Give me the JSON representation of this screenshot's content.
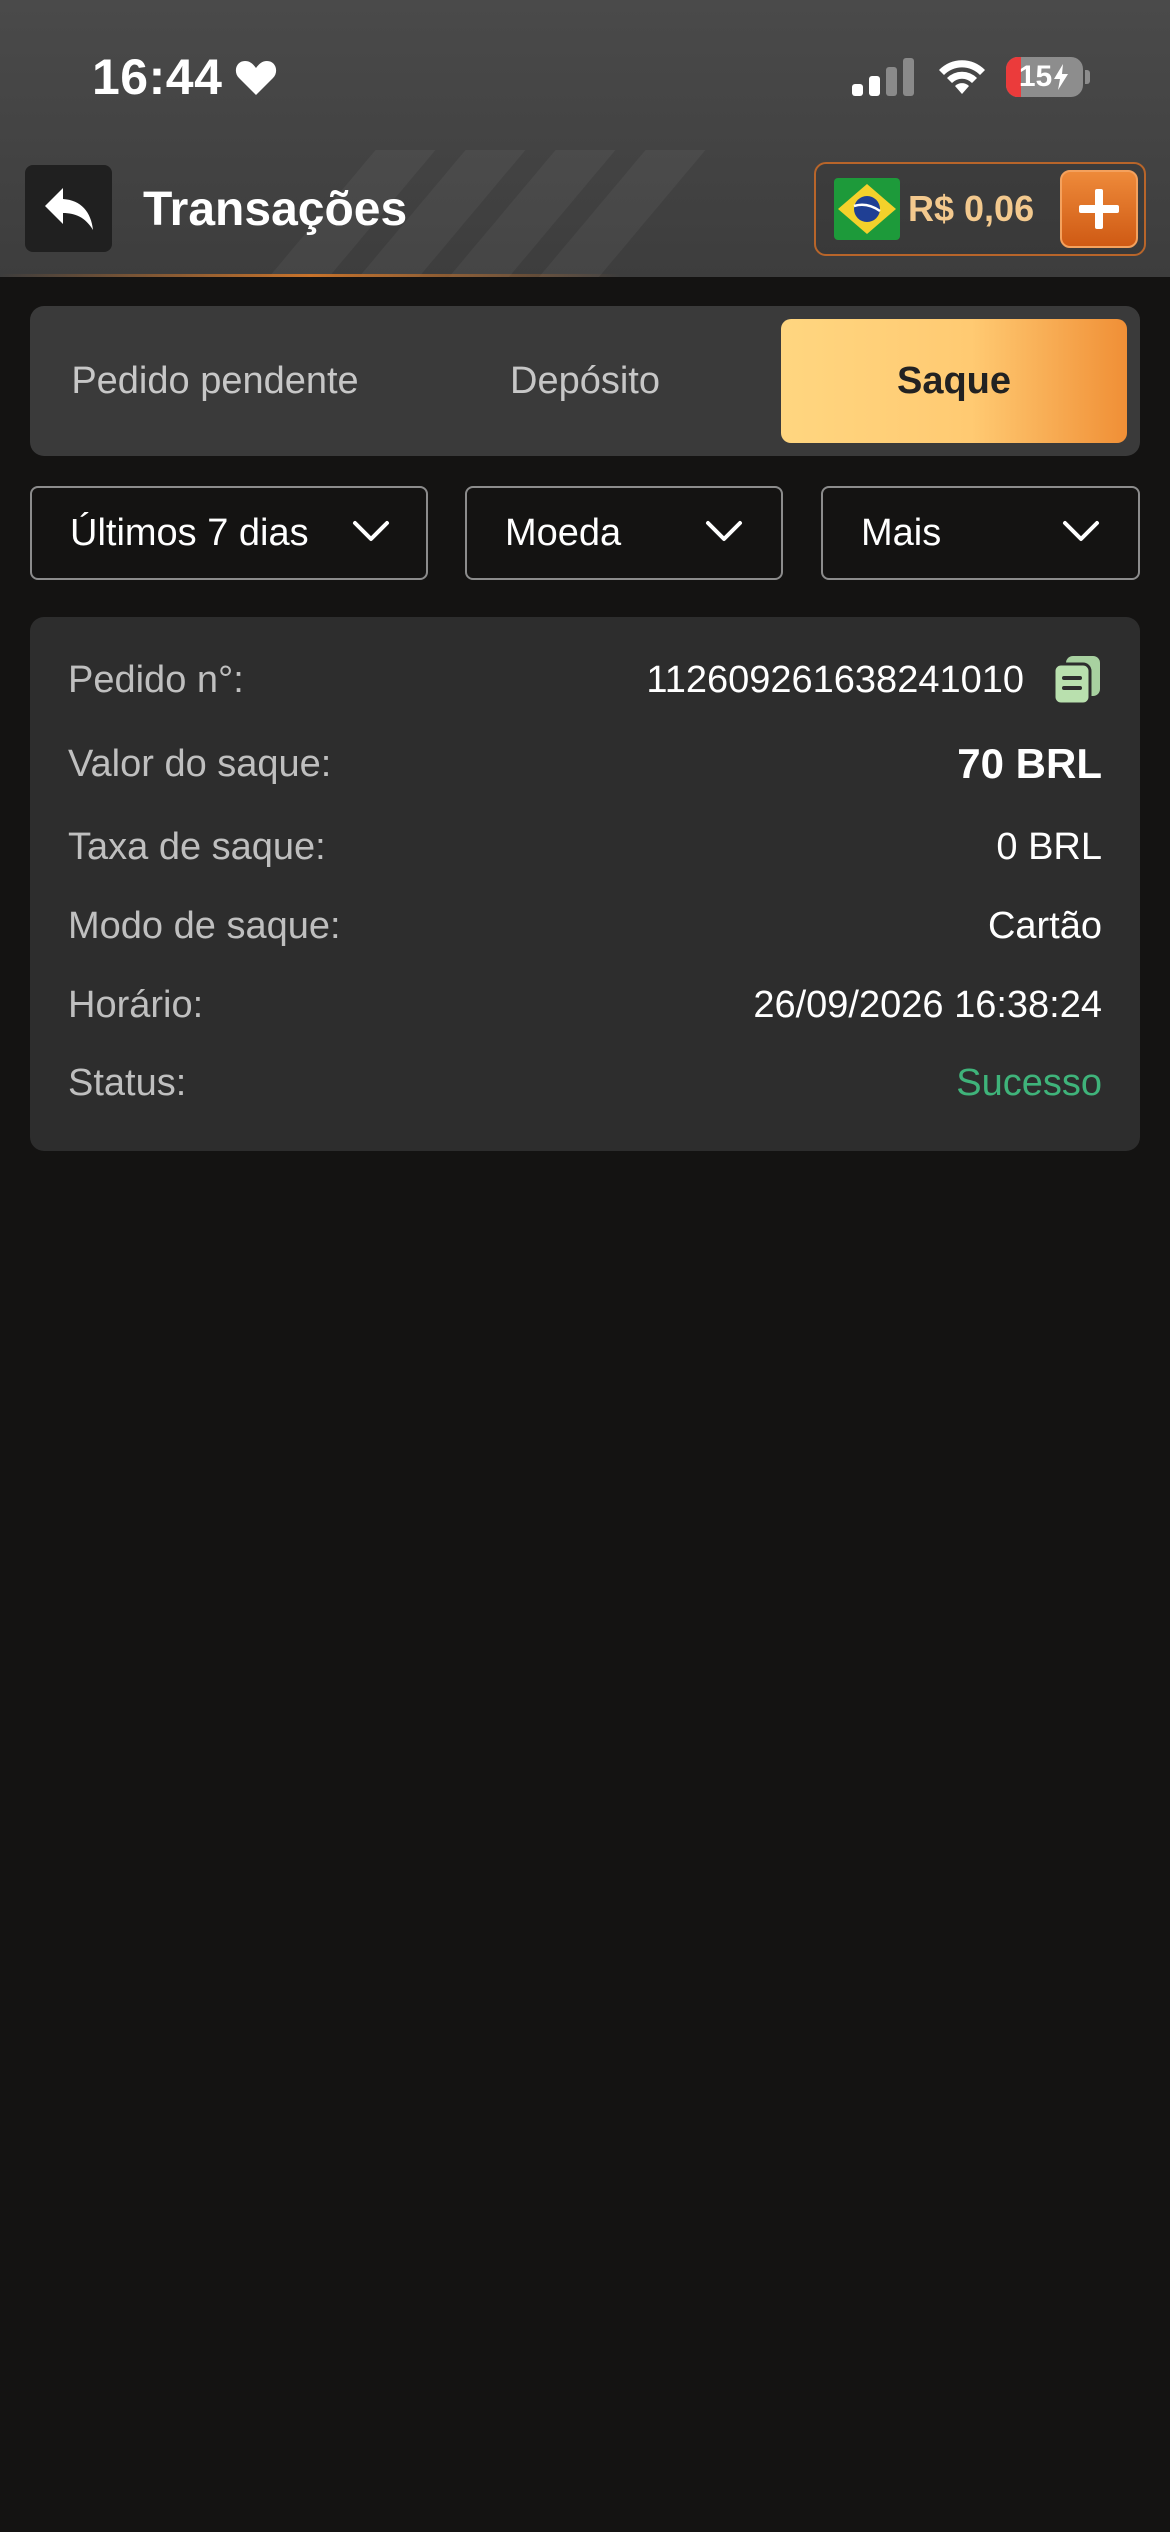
{
  "status_bar": {
    "time": "16:44",
    "battery_level": "15",
    "battery_fraction": 0.15
  },
  "header": {
    "title": "Transações",
    "balance": "R$ 0,06"
  },
  "tabs": [
    {
      "label": "Pedido pendente",
      "active": false
    },
    {
      "label": "Depósito",
      "active": false
    },
    {
      "label": "Saque",
      "active": true
    }
  ],
  "filters": [
    {
      "value": "Últimos 7 dias"
    },
    {
      "value": "Moeda"
    },
    {
      "value": "Mais"
    }
  ],
  "transaction": {
    "rows": [
      {
        "label": "Pedido n°:",
        "value": "112609261638241010"
      },
      {
        "label": "Valor do saque:",
        "value": "70 BRL"
      },
      {
        "label": "Taxa de saque:",
        "value": "0 BRL"
      },
      {
        "label": "Modo de saque:",
        "value": "Cartão"
      },
      {
        "label": "Horário:",
        "value": "26/09/2026 16:38:24"
      },
      {
        "label": "Status:",
        "value": "Sucesso"
      }
    ]
  },
  "colors": {
    "accent_orange": "#f08f36",
    "tab_active": "#ffd680",
    "success": "#3fb37a",
    "balance_text": "#f3c98e",
    "background": "#141312"
  },
  "icons": [
    "heart-icon",
    "signal-icon",
    "wifi-icon",
    "battery-icon",
    "back-arrow-icon",
    "brazil-flag-icon",
    "plus-icon",
    "chevron-down-icon",
    "copy-icon"
  ]
}
